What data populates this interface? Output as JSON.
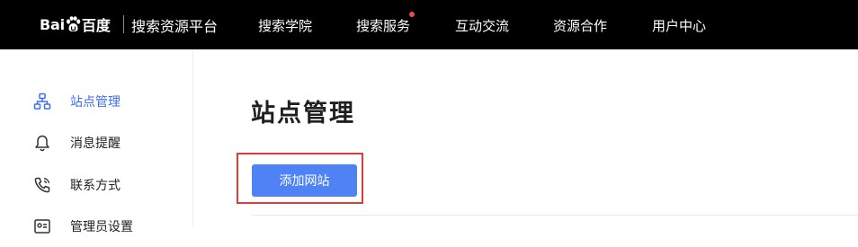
{
  "header": {
    "logo_text_bai": "Bai",
    "logo_text_cn": "百度",
    "product_name": "搜索资源平台",
    "nav": [
      {
        "label": "搜索学院"
      },
      {
        "label": "搜索服务",
        "has_dot": true
      },
      {
        "label": "互动交流"
      },
      {
        "label": "资源合作"
      },
      {
        "label": "用户中心"
      }
    ]
  },
  "sidebar": {
    "items": [
      {
        "label": "站点管理",
        "icon": "sitemap-icon",
        "active": true
      },
      {
        "label": "消息提醒",
        "icon": "bell-icon",
        "active": false
      },
      {
        "label": "联系方式",
        "icon": "phone-icon",
        "active": false
      },
      {
        "label": "管理员设置",
        "icon": "admin-settings-icon",
        "active": false
      }
    ]
  },
  "main": {
    "title": "站点管理",
    "add_button_label": "添加网站"
  },
  "colors": {
    "topbar_bg": "#000000",
    "accent": "#4e82f5",
    "active_text": "#3b6ff0",
    "highlight_border": "#e43a3a",
    "notification_dot": "#f0445b"
  }
}
